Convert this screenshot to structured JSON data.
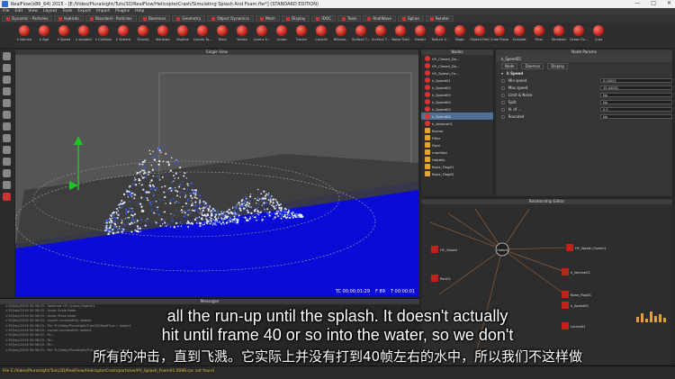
{
  "window": {
    "title": "RealFlow(x86_64) 2015 - [E:/Video/Pluralsight/Tuts/3D/RealFlow/HelicopterCrash/Simulating Splash And Foam.flw*] (STANDARD EDITION)"
  },
  "menu": [
    "File",
    "Edit",
    "View",
    "Layout",
    "Tools",
    "Export",
    "Import",
    "Plugins",
    "Help"
  ],
  "shelf_tabs": [
    "Dynamic - Particles",
    "Hybrido",
    "Standard - Particles",
    "Daemons",
    "Geometry",
    "Object Dynamics",
    "Mesh",
    "Display",
    "IDOC",
    "Tools",
    "RealWave",
    "Spline",
    "Render"
  ],
  "toolbar": [
    "k Volume",
    "k Age",
    "k Speed",
    "k Isolated",
    "k Collision",
    "k Sphere",
    "Gravity",
    "Attractor",
    "Dspline",
    "Coords To...",
    "Wind",
    "Vortex",
    "Lorenz E...",
    "Limbo",
    "Tractor",
    "Coriolis",
    "Bilinear...",
    "Surface T...",
    "Surface T...",
    "Noise Field",
    "Heater",
    "Texture V...",
    "Magic",
    "Object Field",
    "Cube Plane",
    "Scripted",
    "Filter",
    "Shredder",
    "Ocean Fo...",
    "Crea"
  ],
  "viewport": {
    "title": "Single View",
    "timecode": "TC 00:00:01:29",
    "frame": "F 89",
    "time": "T 00:00:01"
  },
  "nodes": {
    "title": "Nodes",
    "items": [
      "HY_Closed_Do...",
      "HY_Closed_Do...",
      "HY_Splash_Fo...",
      "k_Speed01",
      "k_Speed02",
      "k_Speed03",
      "k_Speed04",
      "k_Speed05",
      "k_Speed06",
      "k_Volume01",
      "Burner",
      "Filter",
      "Swirl",
      "manifold",
      "Hobbits",
      "Bone_Flag01",
      "Bone_Flag02"
    ],
    "selected_index": 8
  },
  "params": {
    "title": "Node Params",
    "node": "k_Speed05",
    "tabs": [
      "Node",
      "Daemon",
      "Display"
    ],
    "section": "k Speed",
    "rows": [
      {
        "label": "Min speed",
        "value": "0.00001"
      },
      {
        "label": "Max speed",
        "value": "15.00001"
      },
      {
        "label": "Limit & Noise",
        "value": "No"
      },
      {
        "label": "Split",
        "value": "No"
      },
      {
        "label": "N. of ...",
        "value": "0.5"
      },
      {
        "label": "Rounded",
        "value": "No"
      }
    ]
  },
  "relationship": {
    "title": "Relationship Editor",
    "nodes": [
      "Hobbit1",
      "HY_Splash_Foam01",
      "HY_Closed",
      "Part02",
      "k_Volume01",
      "Bone_Flag01",
      "k_Speed05",
      "Lorenz01"
    ]
  },
  "messages": {
    "title": "Messages",
    "lines": [
      ">19/July/2016 00:36:03 - Selected: HY_Splash_Foam01",
      ">19/July/2016 00:36:03 - Undo: Scale Node",
      ">19/July/2016 00:36:03 - Undo: Move Node",
      ">19/July/2016 00:36:03 - Layout successfully loaded.",
      ">19/July/2016 00:36:03 - File 'E:/Video/Pluralsight/Tuts/3D/RealFlow...' loaded",
      ">19/July/2016 00:36:03 - Layout successfully loaded.",
      ">19/July/2016 00:36:03 - Fin...",
      ">19/July/2016 00:36:03 - Fin...",
      ">19/July/2016 00:36:03 - Fin...",
      ">19/July/2016 00:36:03 - File 'E:/Video/Pluralsight/Tuts/3D/RealFlow...' saved"
    ]
  },
  "status": "File E:/Video/Pluralsight/Tuts/3D/RealFlow/HelicopterCrash/particles/HY_Splash_Foam01.0089.rpc not found",
  "subtitles": {
    "en_line1": "all the run-up until the splash. It doesn't actually",
    "en_line2": "hit until frame 40 or so into the water, so we don't",
    "zh_line": "所有的冲击，直到飞溅。它实际上并没有打到40帧左右的水中，所以我们不这样做"
  },
  "colors": {
    "accent": "#c0221a",
    "water": "#0a0ad6",
    "selection": "#4d6f98"
  }
}
